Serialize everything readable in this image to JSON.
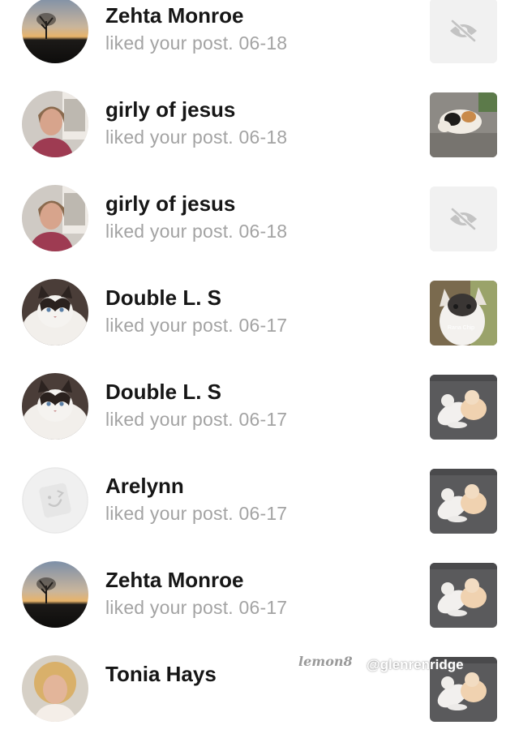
{
  "notifications": [
    {
      "name": "Zehta Monroe",
      "text": "liked your post. 06-18",
      "avatar": "sunset-tree-avatar",
      "thumb": "hidden-post"
    },
    {
      "name": "girly of jesus",
      "text": "liked your post. 06-18",
      "avatar": "girl-photo-avatar",
      "thumb": "calico-cat-photo"
    },
    {
      "name": "girly of jesus",
      "text": "liked your post. 06-18",
      "avatar": "girl-photo-avatar",
      "thumb": "hidden-post"
    },
    {
      "name": "Double L. S",
      "text": "liked your post. 06-17",
      "avatar": "ragdoll-cat-avatar",
      "thumb": "kitten-face-photo"
    },
    {
      "name": "Double L. S",
      "text": "liked your post. 06-17",
      "avatar": "ragdoll-cat-avatar",
      "thumb": "kittens-playing-photo"
    },
    {
      "name": "Arelynn",
      "text": "liked your post. 06-17",
      "avatar": "default-avatar",
      "thumb": "kittens-playing-photo"
    },
    {
      "name": "Zehta Monroe",
      "text": "liked your post. 06-17",
      "avatar": "sunset-tree-avatar",
      "thumb": "kittens-playing-photo"
    },
    {
      "name": "Tonia Hays",
      "text": "",
      "avatar": "woman-photo-avatar",
      "thumb": "kittens-playing-photo"
    }
  ],
  "watermark": {
    "brand": "lemon8",
    "handle": "@glenrenridge"
  },
  "thumb_caption": "Rana Chip"
}
